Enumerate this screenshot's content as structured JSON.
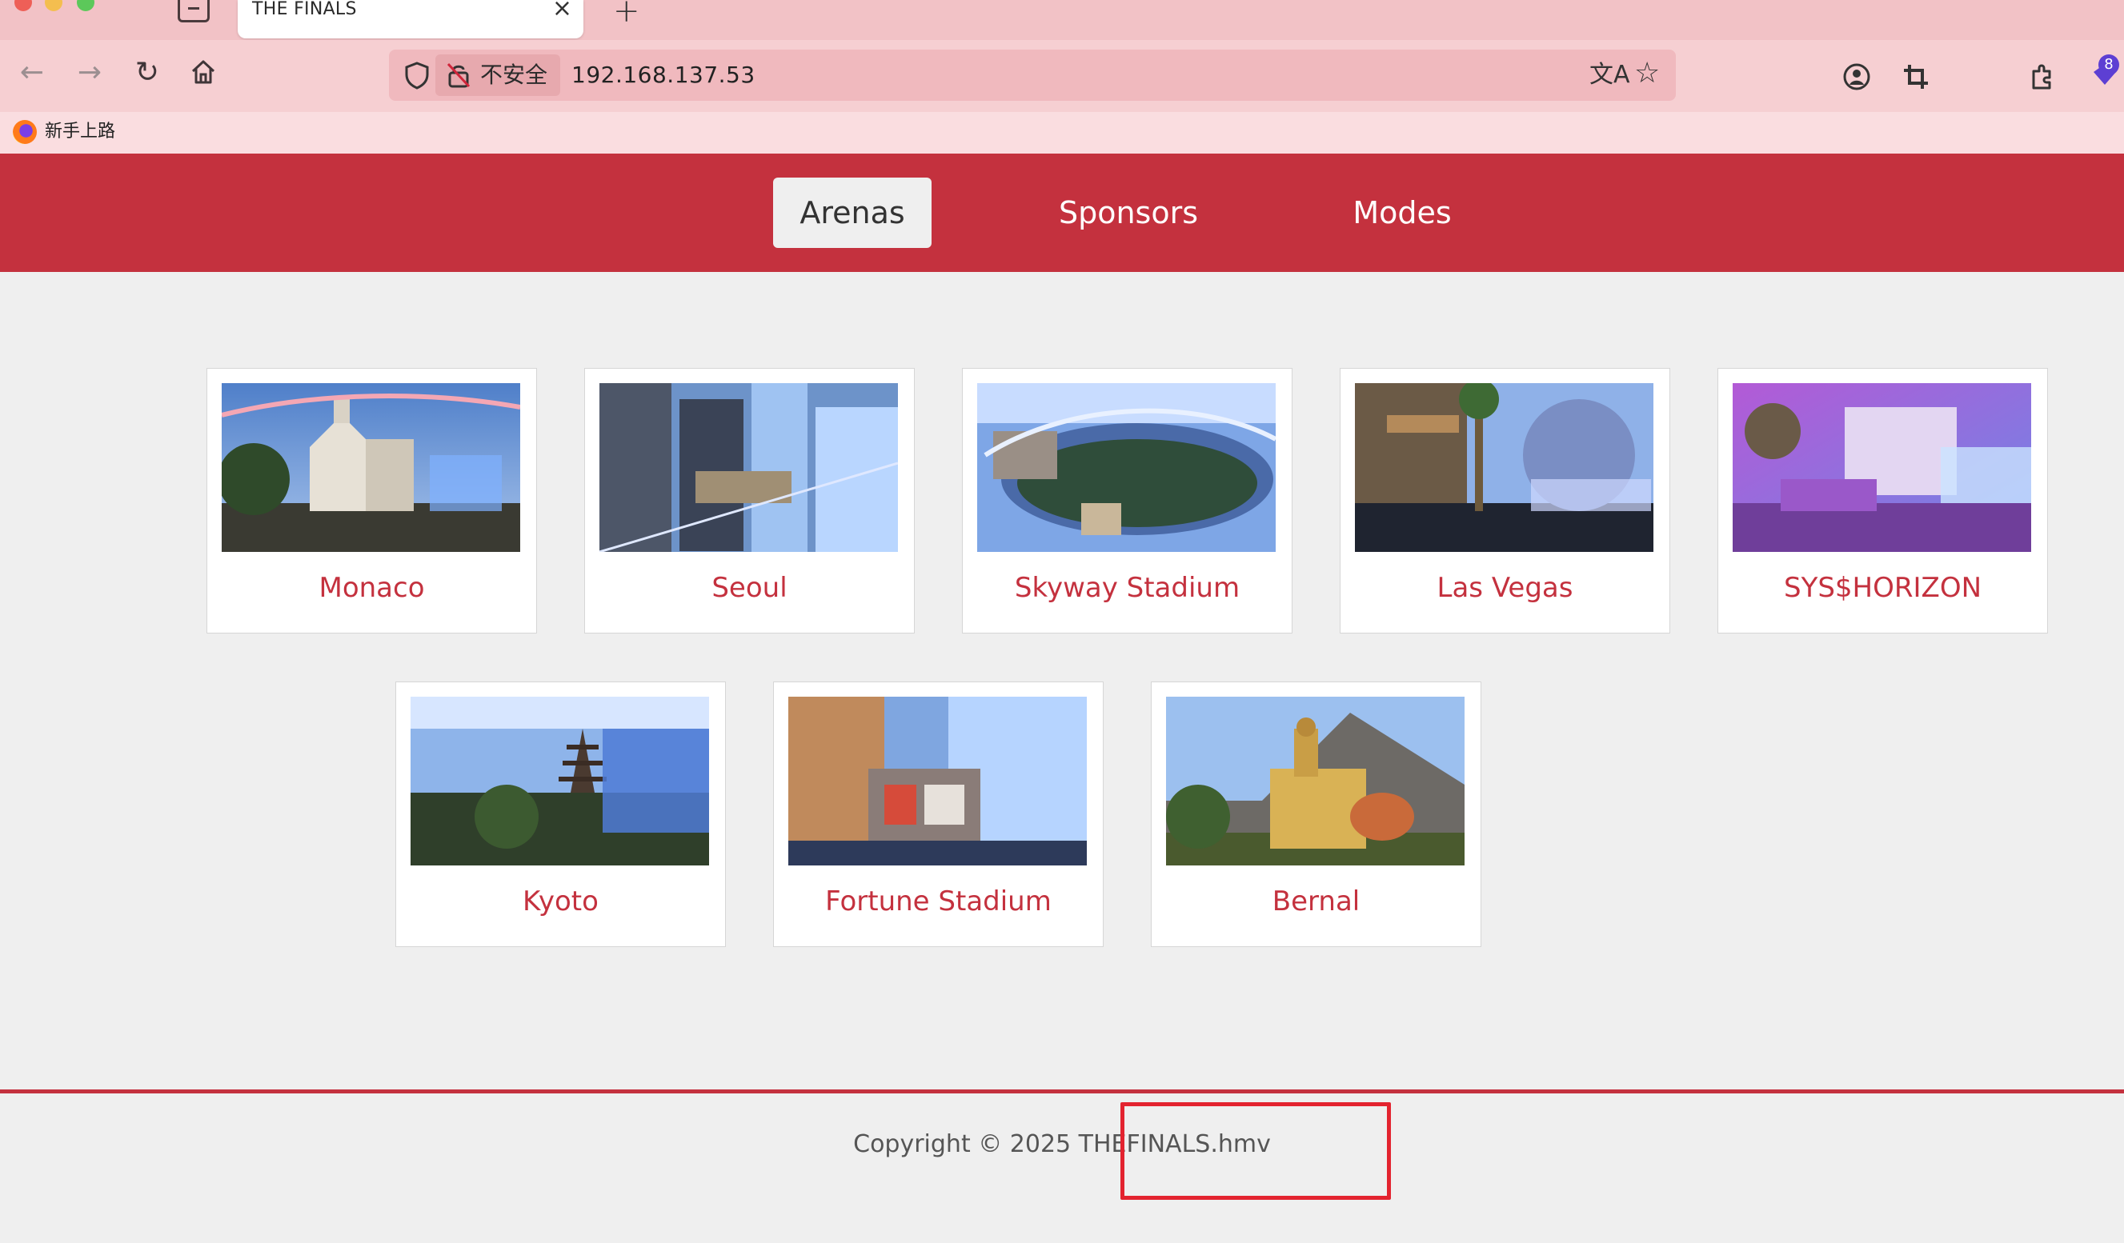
{
  "browser": {
    "tab_title": "THE FINALS",
    "url": "192.168.137.53",
    "security_label": "不安全",
    "bookmark_label": "新手上路",
    "extension_badge": "8"
  },
  "site_nav": {
    "items": [
      {
        "label": "Arenas",
        "active": true
      },
      {
        "label": "Sponsors",
        "active": false
      },
      {
        "label": "Modes",
        "active": false
      }
    ]
  },
  "arenas": [
    {
      "name": "Monaco"
    },
    {
      "name": "Seoul"
    },
    {
      "name": "Skyway Stadium"
    },
    {
      "name": "Las Vegas"
    },
    {
      "name": "SYS$HORIZON"
    },
    {
      "name": "Kyoto"
    },
    {
      "name": "Fortune Stadium"
    },
    {
      "name": "Bernal"
    }
  ],
  "footer": {
    "copyright": "Copyright © 2025 THEFINALS.hmv"
  },
  "colors": {
    "brand_red": "#c4313e",
    "highlight_red": "#e3232f"
  }
}
